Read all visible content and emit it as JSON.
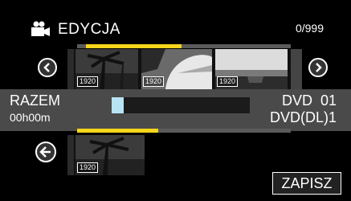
{
  "header": {
    "title": "EDYCJA",
    "counter": "0/999",
    "camera_icon": "movie-camera-icon"
  },
  "filmstrip_top": {
    "thumbnails": [
      {
        "badge": "1920"
      },
      {
        "badge": "1920"
      },
      {
        "badge": "1920"
      }
    ],
    "selected_fraction": 0.45
  },
  "navigation": {
    "prev_icon": "chevron-left-circle-icon",
    "next_icon": "chevron-right-circle-icon",
    "back_icon": "arrow-left-circle-icon"
  },
  "summary": {
    "label": "RAZEM",
    "duration": "00h00m",
    "progress_fraction": 0.09,
    "disc_line1": "DVD  01",
    "disc_line2": "DVD(DL)1"
  },
  "filmstrip_bottom": {
    "thumbnails": [
      {
        "badge": "1920"
      }
    ],
    "selected_fraction": 1.0
  },
  "actions": {
    "save_label": "ZAPISZ"
  },
  "colors": {
    "accent_yellow": "#f7d51b",
    "progress_blue": "#b7e3f3",
    "band_gray": "#4a4a4a"
  }
}
